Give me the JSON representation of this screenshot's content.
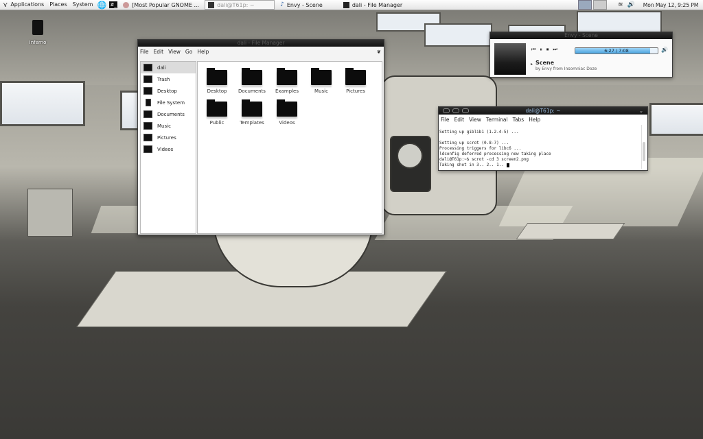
{
  "top_panel": {
    "menus": [
      "Applications",
      "Places",
      "System"
    ],
    "tasks": [
      {
        "label": "[Most Popular GNOME ...",
        "icon": "browser-icon",
        "active": false
      },
      {
        "label": "dali@T61p: ~",
        "icon": "terminal-icon",
        "active": true
      },
      {
        "label": "Envy - Scene",
        "icon": "music-note-icon",
        "active": false
      },
      {
        "label": "dali - File Manager",
        "icon": "file-manager-icon",
        "active": false
      }
    ],
    "clock": "Mon May 12,  9:25 PM"
  },
  "desktop": {
    "icon_label": "Inferno"
  },
  "file_manager": {
    "title": "dali - File Manager",
    "menu": [
      "File",
      "Edit",
      "View",
      "Go",
      "Help"
    ],
    "sidebar": [
      "dali",
      "Trash",
      "Desktop",
      "File System",
      "Documents",
      "Music",
      "Pictures",
      "Videos"
    ],
    "selected_sidebar": "dali",
    "folders": [
      "Desktop",
      "Documents",
      "Examples",
      "Music",
      "Pictures",
      "Public",
      "Templates",
      "Videos"
    ]
  },
  "media_player": {
    "title": "Envy - Scene",
    "time": "6:27 / 7:08",
    "progress": 0.91,
    "song": "Scene",
    "sub": "by Envy from Insomniac Doze"
  },
  "terminal": {
    "title": "dali@T61p: ~",
    "menu": [
      "File",
      "Edit",
      "View",
      "Terminal",
      "Tabs",
      "Help"
    ],
    "lines": [
      "Setting up giblib1 (1.2.4-5) ...",
      "",
      "Setting up scrot (0.8-7) ...",
      "Processing triggers for libc6 ...",
      "ldconfig deferred processing now taking place",
      "dali@T61p:~$ scrot -cd 3 screen2.png",
      "Taking shot in 3.. 2.. 1.. "
    ]
  }
}
